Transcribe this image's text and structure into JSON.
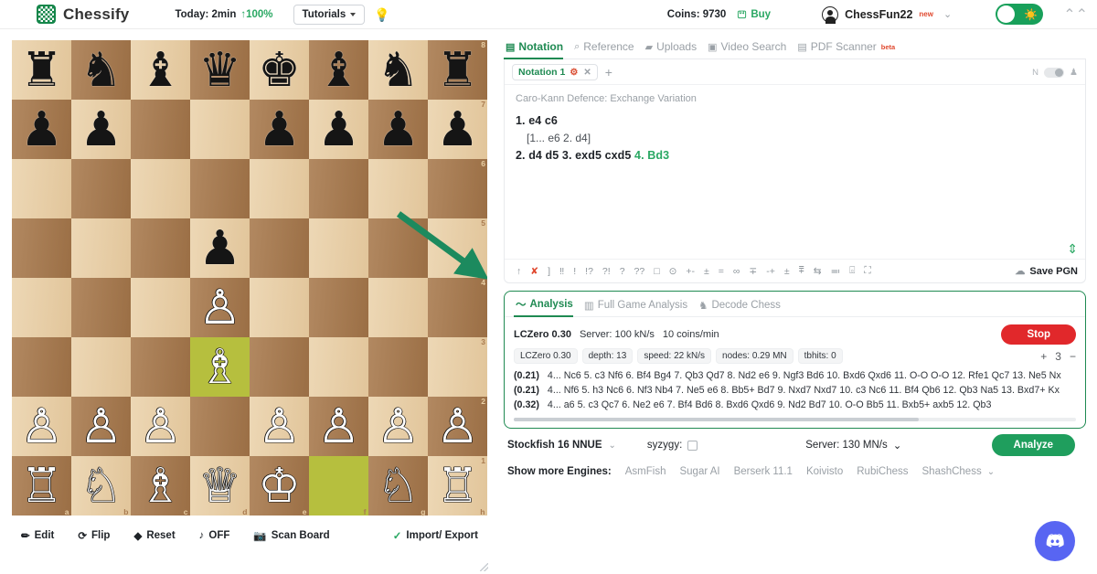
{
  "header": {
    "brand": "Chessify",
    "today_label": "Today: 2min",
    "today_pct": "↑100%",
    "tutorials": "Tutorials",
    "bulb_icon": "lightbulb-icon",
    "coins": "Coins: 9730",
    "buy": "Buy",
    "username": "ChessFun22",
    "new_badge": "new",
    "theme_toggle_icon": "sun-icon",
    "collapse_icon": "chevron-double-up-icon"
  },
  "board": {
    "files": [
      "a",
      "b",
      "c",
      "d",
      "e",
      "f",
      "g",
      "h"
    ],
    "ranks": [
      "8",
      "7",
      "6",
      "5",
      "4",
      "3",
      "2",
      "1"
    ],
    "highlight_squares": [
      "d3",
      "f1"
    ],
    "arrow": {
      "from": "f5",
      "to": "h4",
      "color": "#1c8a5e"
    },
    "position": [
      [
        "r",
        "n",
        "b",
        "q",
        "k",
        "b",
        "n",
        "r"
      ],
      [
        "p",
        "p",
        "",
        "",
        "p",
        "p",
        "p",
        "p"
      ],
      [
        "",
        "",
        "",
        "",
        "",
        "",
        "",
        ""
      ],
      [
        "",
        "",
        "",
        "p",
        "",
        "",
        "",
        ""
      ],
      [
        "",
        "",
        "",
        "P",
        "",
        "",
        "",
        ""
      ],
      [
        "",
        "",
        "",
        "B",
        "",
        "",
        "",
        ""
      ],
      [
        "P",
        "P",
        "P",
        "",
        "P",
        "P",
        "P",
        "P"
      ],
      [
        "R",
        "N",
        "B",
        "Q",
        "K",
        "",
        "N",
        "R"
      ]
    ],
    "tools": [
      {
        "icon": "pencil-icon",
        "label": "Edit"
      },
      {
        "icon": "flip-icon",
        "label": "Flip"
      },
      {
        "icon": "layers-icon",
        "label": "Reset"
      },
      {
        "icon": "sound-icon",
        "label": "OFF"
      },
      {
        "icon": "camera-icon",
        "label": "Scan Board"
      }
    ],
    "import_export": "Import/ Export"
  },
  "notation": {
    "tabs": [
      {
        "icon": "notation-icon",
        "label": "Notation",
        "active": true
      },
      {
        "icon": "search-icon",
        "label": "Reference",
        "active": false
      },
      {
        "icon": "folder-icon",
        "label": "Uploads",
        "active": false
      },
      {
        "icon": "video-icon",
        "label": "Video Search",
        "active": false
      },
      {
        "icon": "pdf-icon",
        "label": "PDF Scanner",
        "active": false,
        "badge": "beta"
      }
    ],
    "file_tab": "Notation 1",
    "add_tab_icon": "plus-icon",
    "mini_label": "N",
    "opening": "Caro-Kann Defence: Exchange Variation",
    "line1": "1. e4  c6",
    "variation": "[1... e6  2. d4]",
    "line2_plain": "2. d4  d5  3. exd5  cxd5 ",
    "line2_green": " 4. Bd3",
    "annotations": [
      "↑",
      "✘",
      "]",
      "‼",
      "!",
      "!?",
      "?!",
      "?",
      "??",
      "□",
      "⊙",
      "+-",
      "±",
      "=",
      "∞",
      "∓",
      "-+",
      "±",
      "⩱",
      "⇆",
      "≕",
      "⌻",
      "⛶"
    ],
    "save_pgn": "Save PGN",
    "scroll_icon": "scroll-updown-icon"
  },
  "analysis": {
    "tabs": [
      {
        "icon": "line-chart-icon",
        "label": "Analysis",
        "active": true
      },
      {
        "icon": "bar-chart-icon",
        "label": "Full Game Analysis",
        "active": false
      },
      {
        "icon": "decode-icon",
        "label": "Decode Chess",
        "active": false
      }
    ],
    "engine_name": "LCZero 0.30",
    "server_speed": "Server: 100 kN/s",
    "coin_rate": "10 coins/min",
    "stop_button": "Stop",
    "stats": [
      "LCZero 0.30",
      "depth: 13",
      "speed: 22 kN/s",
      "nodes: 0.29 MN",
      "tbhits: 0"
    ],
    "lines_plus": "+",
    "lines_count": "3",
    "lines_minus": "−",
    "variations": [
      {
        "score": "(0.21)",
        "moves": "4... Nc6 5. c3 Nf6 6. Bf4 Bg4 7. Qb3 Qd7 8. Nd2 e6 9. Ngf3 Bd6 10. Bxd6 Qxd6 11. O-O O-O 12. Rfe1 Qc7 13. Ne5 Nx"
      },
      {
        "score": "(0.21)",
        "moves": "4... Nf6 5. h3 Nc6 6. Nf3 Nb4 7. Ne5 e6 8. Bb5+ Bd7 9. Nxd7 Nxd7 10. c3 Nc6 11. Bf4 Qb6 12. Qb3 Na5 13. Bxd7+ Kx"
      },
      {
        "score": "(0.32)",
        "moves": "4... a6 5. c3 Qc7 6. Ne2 e6 7. Bf4 Bd6 8. Bxd6 Qxd6 9. Nd2 Bd7 10. O-O Bb5 11. Bxb5+ axb5 12. Qb3"
      }
    ],
    "engine_select": "Stockfish 16 NNUE",
    "syzygy_label": "syzygy:",
    "server_select": "Server: 130 MN/s",
    "analyze_button": "Analyze",
    "more_engines_label": "Show more Engines:",
    "more_engines": [
      "AsmFish",
      "Sugar AI",
      "Berserk 11.1",
      "Koivisto",
      "RubiChess",
      "ShashChess"
    ]
  },
  "fab": {
    "icon": "discord-icon"
  }
}
